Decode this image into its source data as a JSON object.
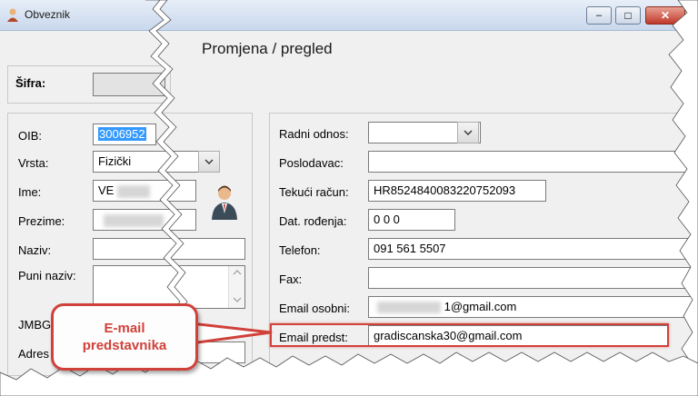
{
  "window": {
    "title": "Obveznik",
    "minimize_label": "–",
    "maximize_label": "□",
    "close_label": "✕"
  },
  "heading": "Promjena / pregled",
  "sifra": {
    "label": "Šifra:",
    "value": ""
  },
  "left_form": {
    "oib": {
      "label": "OIB:",
      "value": "3006952"
    },
    "vrsta": {
      "label": "Vrsta:",
      "value": "Fizički"
    },
    "ime": {
      "label": "Ime:",
      "value": "VE"
    },
    "prezime": {
      "label": "Prezime:",
      "value": ""
    },
    "naziv": {
      "label": "Naziv:",
      "value": ""
    },
    "puni_naziv": {
      "label": "Puni naziv:",
      "value": ""
    },
    "jmbg": {
      "label": "JMBG"
    },
    "adresa": {
      "label": "Adres"
    }
  },
  "right_form": {
    "radni_odnos": {
      "label": "Radni odnos:",
      "value": ""
    },
    "poslodavac": {
      "label": "Poslodavac:",
      "value": ""
    },
    "tekuci_racun": {
      "label": "Tekući račun:",
      "value": "HR8524840083220752093"
    },
    "dat_rodenja": {
      "label": "Dat. rođenja:",
      "value": "0 0 0"
    },
    "telefon": {
      "label": "Telefon:",
      "value": "091 561 5507"
    },
    "fax": {
      "label": "Fax:",
      "value": ""
    },
    "email_osobni": {
      "label": "Email osobni:",
      "value": "1@gmail.com"
    },
    "email_predst": {
      "label": "Email predst:",
      "value": "gradiscanska30@gmail.com"
    }
  },
  "callout": {
    "line1": "E-mail",
    "line2": "predstavnika"
  },
  "colors": {
    "callout_red": "#d0413a",
    "selection_blue": "#3399ff"
  }
}
